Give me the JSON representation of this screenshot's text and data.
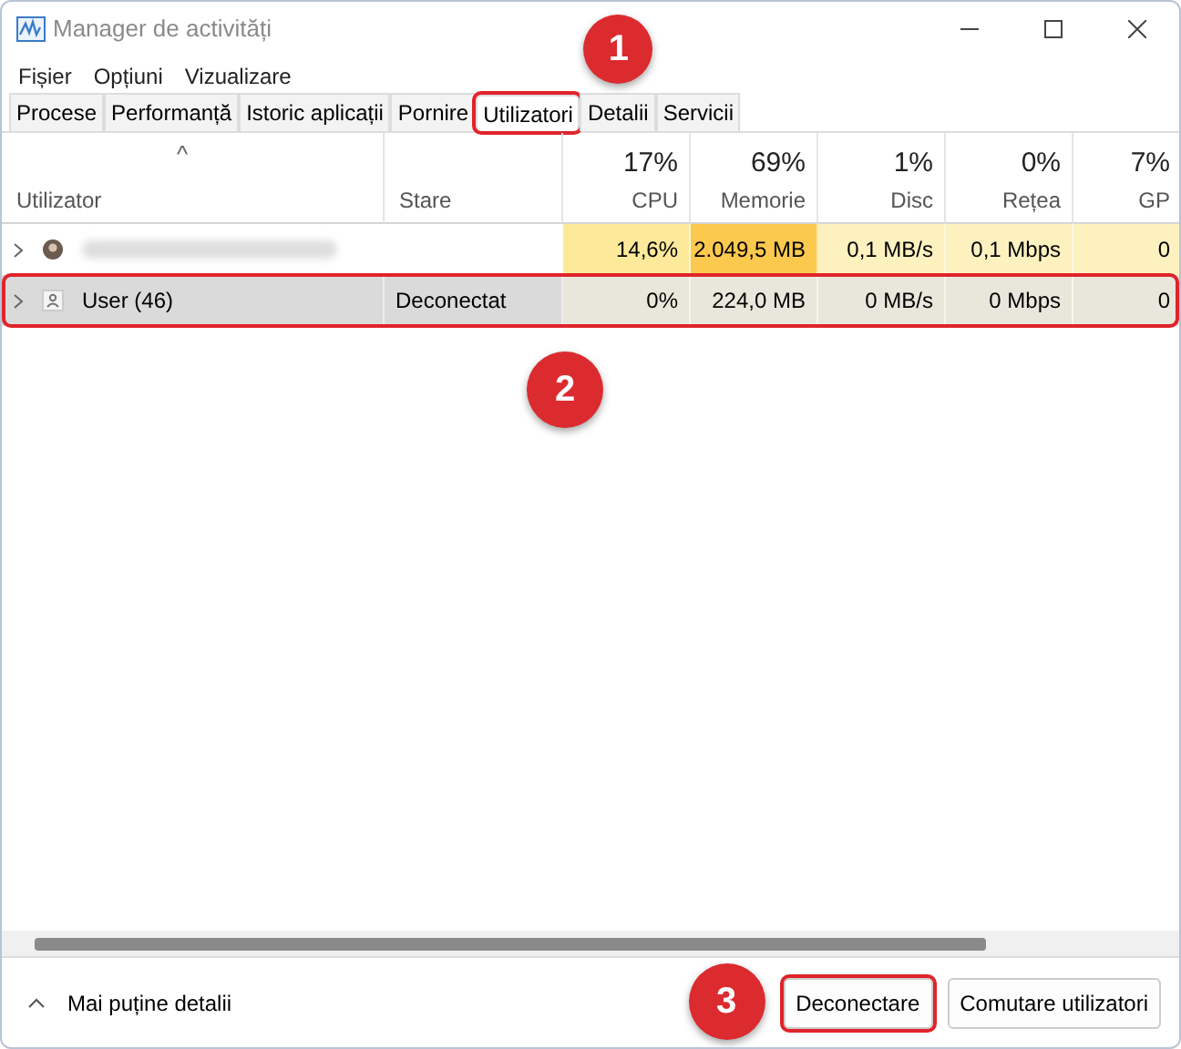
{
  "window": {
    "title": "Manager de activități"
  },
  "menu": [
    "Fișier",
    "Opțiuni",
    "Vizualizare"
  ],
  "tabs": [
    {
      "label": "Procese",
      "selected": false,
      "highlighted": false
    },
    {
      "label": "Performanță",
      "selected": false,
      "highlighted": false
    },
    {
      "label": "Istoric aplicații",
      "selected": false,
      "highlighted": false
    },
    {
      "label": "Pornire",
      "selected": false,
      "highlighted": false
    },
    {
      "label": "Utilizatori",
      "selected": true,
      "highlighted": true,
      "callout": "1"
    },
    {
      "label": "Detalii",
      "selected": false,
      "highlighted": false
    },
    {
      "label": "Servicii",
      "selected": false,
      "highlighted": false
    }
  ],
  "table": {
    "sort_indicator": "^",
    "columns": [
      {
        "label": "Utilizator"
      },
      {
        "label": "Stare"
      },
      {
        "label": "CPU",
        "percent": "17%"
      },
      {
        "label": "Memorie",
        "percent": "69%"
      },
      {
        "label": "Disc",
        "percent": "1%"
      },
      {
        "label": "Rețea",
        "percent": "0%"
      },
      {
        "label": "GP",
        "percent": "7%"
      }
    ],
    "rows": [
      {
        "selected": false,
        "highlighted": false,
        "kind": "photo",
        "cells": [
          {
            "redacted": true
          },
          {
            "text": ""
          },
          {
            "text": "14,6%",
            "color": "#fde99a"
          },
          {
            "text": "2.049,5 MB",
            "color": "#fcc94f"
          },
          {
            "text": "0,1 MB/s",
            "color": "#fdf1c0"
          },
          {
            "text": "0,1 Mbps",
            "color": "#fdf1c0"
          },
          {
            "text": "0",
            "color": "#fdf1c0"
          }
        ]
      },
      {
        "selected": true,
        "highlighted": true,
        "callout": "2",
        "kind": "generic",
        "cells": [
          {
            "text": "User (46)",
            "redacted": false
          },
          {
            "text": "Deconectat"
          },
          {
            "text": "0%",
            "color": "#e9e7dc"
          },
          {
            "text": "224,0 MB",
            "color": "#e9e7dc"
          },
          {
            "text": "0 MB/s",
            "color": "#e9e7dc"
          },
          {
            "text": "0 Mbps",
            "color": "#e9e7dc"
          },
          {
            "text": "0",
            "color": "#e9e7dc"
          }
        ]
      }
    ]
  },
  "footer": {
    "details_toggle": "Mai puține detalii",
    "buttons": [
      {
        "label": "Deconectare",
        "highlighted": true,
        "callout": "3"
      },
      {
        "label": "Comutare utilizatori",
        "highlighted": false
      }
    ]
  }
}
